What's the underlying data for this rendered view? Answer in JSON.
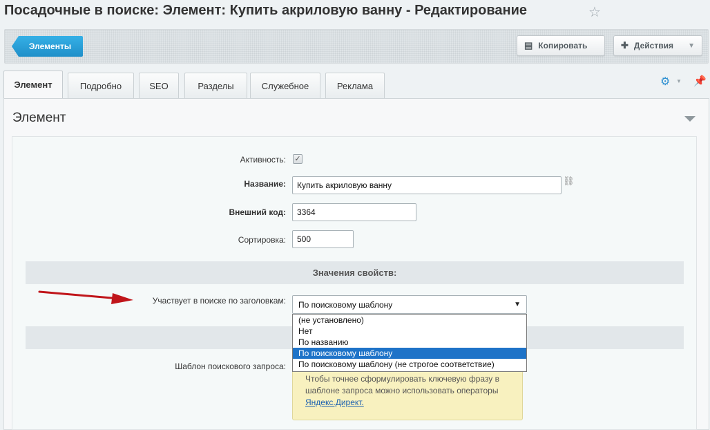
{
  "page": {
    "title": "Посадочные в поиске: Элемент: Купить акриловую ванну - Редактирование"
  },
  "toolbar": {
    "back_label": "Элементы",
    "copy_label": "Копировать",
    "actions_label": "Действия"
  },
  "tabs": [
    {
      "label": "Элемент",
      "active": true
    },
    {
      "label": "Подробно"
    },
    {
      "label": "SEO"
    },
    {
      "label": "Разделы"
    },
    {
      "label": "Служебное"
    },
    {
      "label": "Реклама"
    }
  ],
  "section": {
    "title": "Элемент"
  },
  "form": {
    "active_label": "Активность:",
    "active_checked": true,
    "name_label": "Название:",
    "name_value": "Купить акриловую ванну",
    "external_code_label": "Внешний код:",
    "external_code_value": "3364",
    "sort_label": "Сортировка:",
    "sort_value": "500",
    "properties_header": "Значения свойств:",
    "search_by_title_label": "Участвует в поиске по заголовкам:",
    "search_by_title_value": "По поисковому шаблону",
    "search_by_title_options": [
      "(не установлено)",
      "Нет",
      "По названию",
      "По поисковому шаблону",
      "По поисковому шаблону (не строгое соответствие)"
    ],
    "search_template_label": "Шаблон поискового запроса:",
    "hint_text": "Чтобы точнее сформулировать ключевую фразу в шаблоне запроса можно использовать операторы",
    "hint_link": "Яндекс.Директ."
  },
  "colors": {
    "accent_blue": "#1f8fc9",
    "selected_option": "#1e73c8",
    "arrow_red": "#c0151a",
    "hint_background": "#f8f1bf"
  }
}
